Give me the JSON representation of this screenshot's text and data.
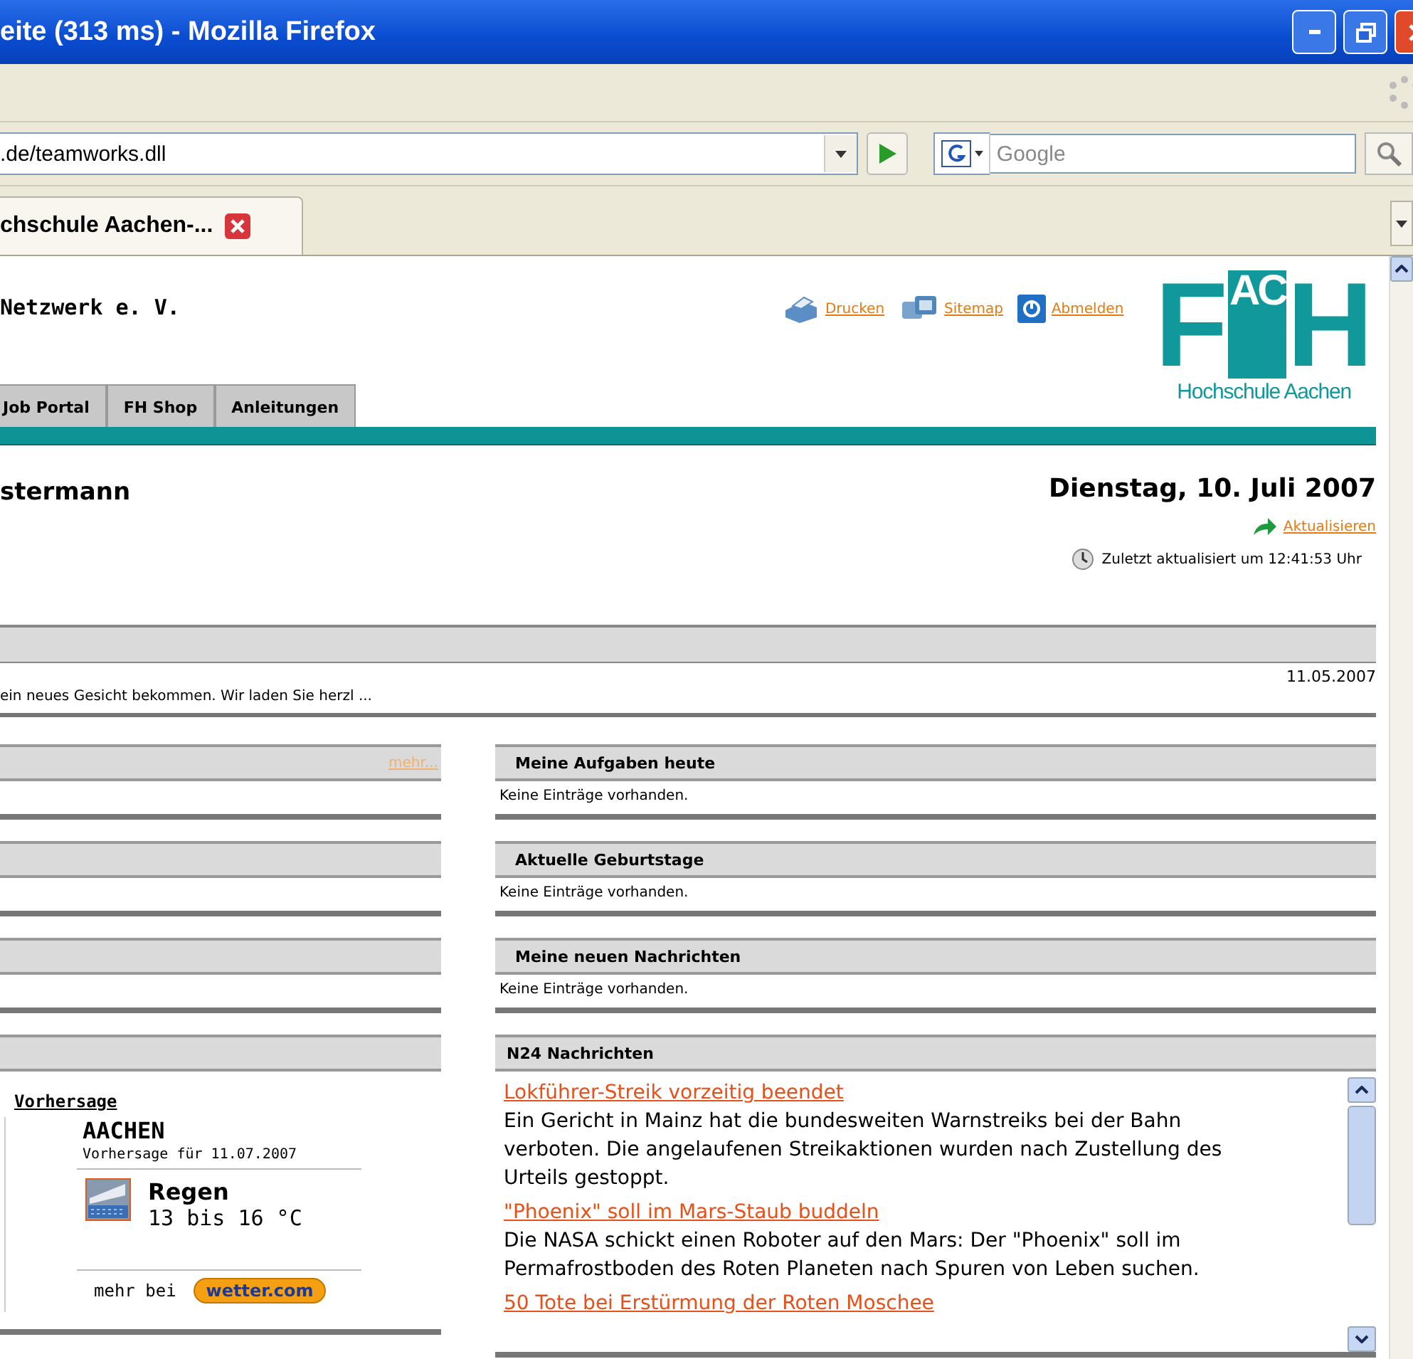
{
  "window": {
    "title": "eite (313 ms) - Mozilla Firefox"
  },
  "toolbar": {
    "url": ".de/teamworks.dll",
    "search_placeholder": "Google"
  },
  "tabs": [
    {
      "label": "chschule Aachen-...",
      "selected": true
    }
  ],
  "header": {
    "org": "Netzwerk e. V.",
    "links": [
      "Drucken",
      "Sitemap",
      "Abmelden"
    ],
    "logo": {
      "parts": [
        "F",
        "AC",
        "H"
      ],
      "caption": "Hochschule Aachen"
    }
  },
  "nav": [
    {
      "label": "Job Portal",
      "selected": false
    },
    {
      "label": "FH Shop",
      "selected": false
    },
    {
      "label": "Anleitungen",
      "selected": false
    }
  ],
  "user": {
    "name": "stermann",
    "date": "Dienstag, 10. Juli 2007",
    "refresh": "Aktualisieren",
    "last_updated": "Zuletzt aktualisiert um 12:41:53 Uhr"
  },
  "announcement": {
    "date": "11.05.2007",
    "text": "ein neues Gesicht bekommen. Wir laden Sie herzl ..."
  },
  "left_panels": [
    {
      "kind": "more",
      "more_link": "mehr..."
    },
    {
      "kind": "empty"
    },
    {
      "kind": "empty"
    },
    {
      "kind": "weather",
      "weather": {
        "heading": "Vorhersage",
        "city": "AACHEN",
        "forecast_for": "Vorhersage für 11.07.2007",
        "condition": "Regen",
        "temperature": "13 bis 16 °C",
        "more_label": "mehr bei",
        "badge": "wetter.com"
      }
    }
  ],
  "right_panels": [
    {
      "kind": "text",
      "title": "Meine Aufgaben heute",
      "text": "Keine Einträge vorhanden."
    },
    {
      "kind": "text",
      "title": "Aktuelle Geburtstage",
      "text": "Keine Einträge vorhanden."
    },
    {
      "kind": "text",
      "title": "Meine neuen Nachrichten",
      "text": "Keine Einträge vorhanden."
    },
    {
      "kind": "news",
      "title": "N24 Nachrichten",
      "items": [
        {
          "headline": "Lokführer-Streik vorzeitig beendet",
          "summary": "Ein Gericht in Mainz hat die bundesweiten Warnstreiks bei der Bahn verboten. Die angelaufenen Streikaktionen wurden nach Zustellung des Urteils gestoppt."
        },
        {
          "headline": "\"Phoenix\" soll im Mars-Staub buddeln",
          "summary": "Die NASA schickt einen Roboter auf den Mars: Der \"Phoenix\" soll im Permafrostboden des Roten Planeten nach Spuren von Leben suchen."
        },
        {
          "headline": "50 Tote bei Erstürmung der Roten Moschee"
        }
      ]
    }
  ]
}
